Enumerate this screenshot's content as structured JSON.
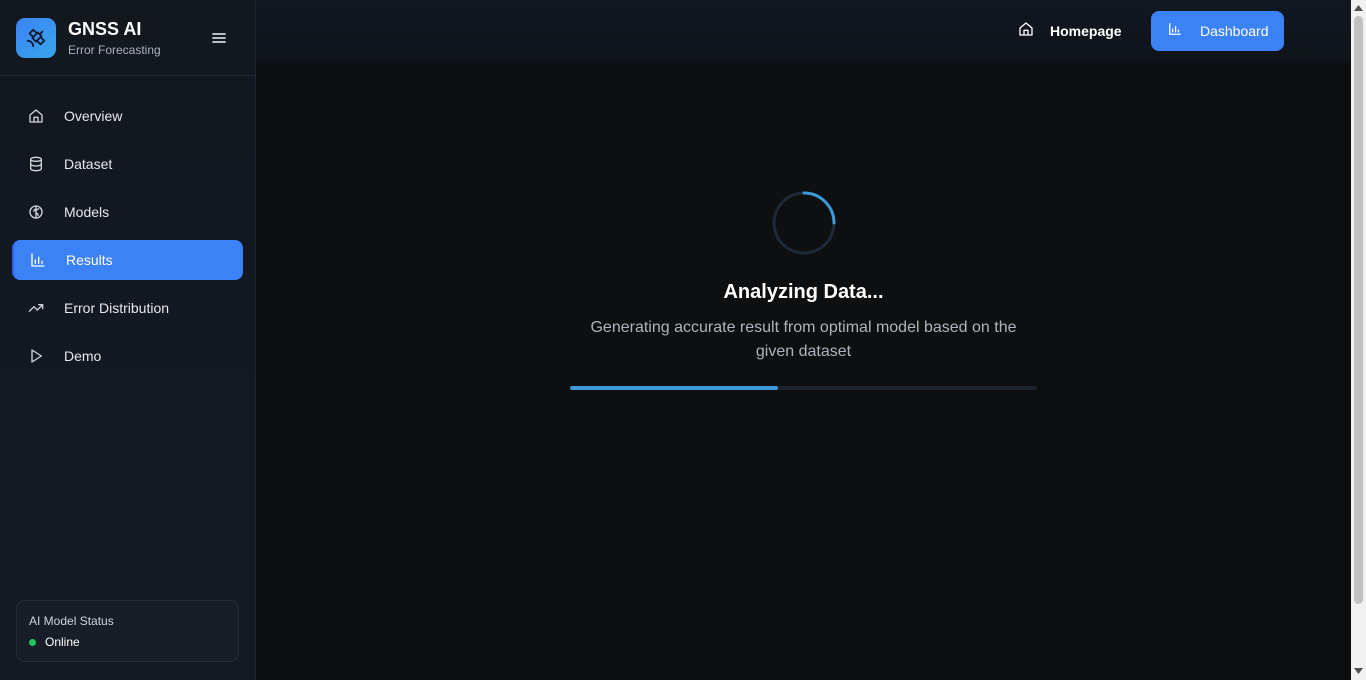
{
  "brand": {
    "title": "GNSS AI",
    "subtitle": "Error Forecasting",
    "icon": "satellite-icon"
  },
  "sidebar": {
    "items": [
      {
        "label": "Overview",
        "icon": "home-icon",
        "active": false
      },
      {
        "label": "Dataset",
        "icon": "database-icon",
        "active": false
      },
      {
        "label": "Models",
        "icon": "brain-icon",
        "active": false
      },
      {
        "label": "Results",
        "icon": "bar-chart-icon",
        "active": true
      },
      {
        "label": "Error Distribution",
        "icon": "trending-up-icon",
        "active": false
      },
      {
        "label": "Demo",
        "icon": "play-icon",
        "active": false
      }
    ],
    "status": {
      "title": "AI Model Status",
      "value": "Online"
    }
  },
  "header": {
    "home_label": "Homepage",
    "dashboard_label": "Dashboard"
  },
  "main": {
    "title": "Analyzing Data...",
    "description": "Generating accurate result from optimal model based on the given dataset",
    "progress": 0.445
  },
  "colors": {
    "accent": "#3b82f6",
    "progress": "#3b9ad9",
    "online": "#22c55e",
    "background": "#0e0f11"
  }
}
